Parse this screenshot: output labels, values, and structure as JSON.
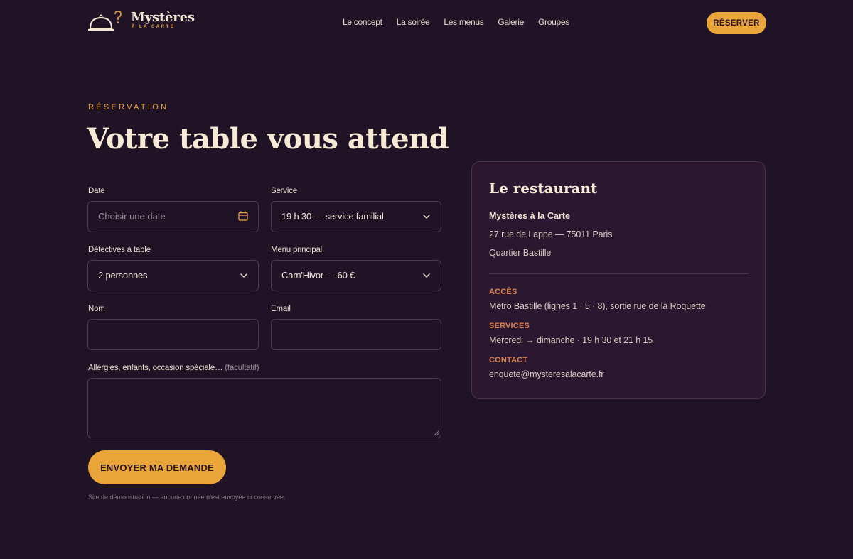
{
  "brand": {
    "name": "Mystères",
    "subtitle": "À LA CARTE"
  },
  "nav": {
    "items": [
      "Le concept",
      "La soirée",
      "Les menus",
      "Galerie",
      "Groupes"
    ],
    "reserve_label": "RÉSERVER"
  },
  "section": {
    "eyebrow": "RÉSERVATION",
    "title": "Votre table vous attend"
  },
  "form": {
    "date": {
      "label": "Date",
      "placeholder": "Choisir une date"
    },
    "service": {
      "label": "Service",
      "value": "19 h 30 — service familial"
    },
    "guests": {
      "label": "Détectives à table",
      "value": "2 personnes"
    },
    "menu": {
      "label": "Menu principal",
      "value": "Carn'Hivor — 60 €"
    },
    "name": {
      "label": "Nom",
      "value": ""
    },
    "email": {
      "label": "Email",
      "value": ""
    },
    "notes": {
      "label": "Allergies, enfants, occasion spéciale…",
      "optional": "(facultatif)",
      "value": ""
    },
    "submit_label": "ENVOYER MA DEMANDE",
    "disclaimer": "Site de démonstration — aucune donnée n'est envoyée ni conservée."
  },
  "restaurant": {
    "title": "Le restaurant",
    "name": "Mystères à la Carte",
    "address": "27 rue de Lappe — 75011 Paris",
    "district": "Quartier Bastille",
    "access_label": "ACCÈS",
    "access": "Métro Bastille (lignes 1 · 5 · 8), sortie rue de la Roquette",
    "services_label": "SERVICES",
    "services": "Mercredi → dimanche · 19 h 30 et 21 h 15",
    "contact_label": "CONTACT",
    "contact": "enquete@mysteresalacarte.fr"
  },
  "colors": {
    "background": "#211326",
    "accent": "#e9a53a",
    "card": "#2c1731",
    "heading_accent": "#d9824e"
  },
  "icons": {
    "logo": "cloche-question-icon",
    "date": "calendar-icon",
    "select": "chevron-down-icon"
  }
}
